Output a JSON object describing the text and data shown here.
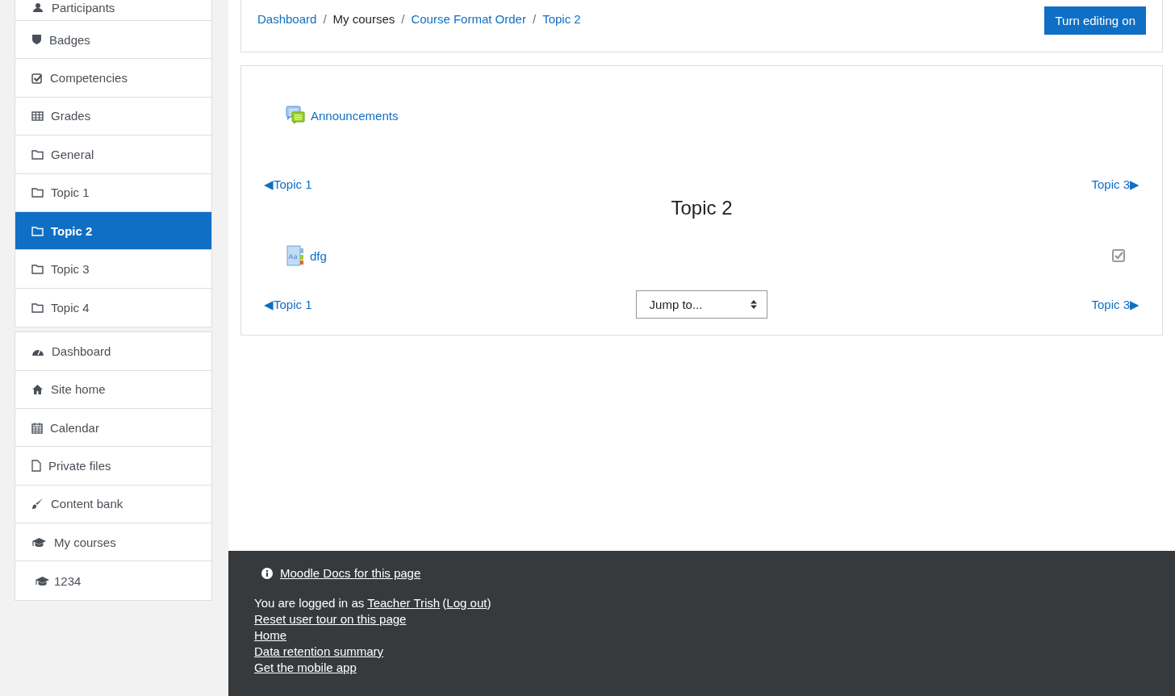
{
  "sidebar": {
    "blocks": [
      {
        "items": [
          {
            "label": "Participants",
            "selected": false
          },
          {
            "label": "Badges",
            "selected": false
          },
          {
            "label": "Competencies",
            "selected": false
          },
          {
            "label": "Grades",
            "selected": false
          },
          {
            "label": "General",
            "selected": false
          },
          {
            "label": "Topic 1",
            "selected": false
          },
          {
            "label": "Topic 2",
            "selected": true
          },
          {
            "label": "Topic 3",
            "selected": false
          },
          {
            "label": "Topic 4",
            "selected": false
          }
        ]
      },
      {
        "items": [
          {
            "label": "Dashboard",
            "selected": false
          },
          {
            "label": "Site home",
            "selected": false
          },
          {
            "label": "Calendar",
            "selected": false
          },
          {
            "label": "Private files",
            "selected": false
          },
          {
            "label": "Content bank",
            "selected": false
          },
          {
            "label": "My courses",
            "selected": false
          },
          {
            "label": "1234",
            "selected": false
          }
        ]
      }
    ]
  },
  "breadcrumb": [
    {
      "label": "Dashboard",
      "link": true
    },
    {
      "separator": "/",
      "label": "My courses",
      "link": false
    },
    {
      "separator": "/",
      "label": "Course Format Order",
      "link": true
    },
    {
      "separator": "/",
      "label": "Topic 2",
      "link": true
    }
  ],
  "edit_button": "Turn editing on",
  "general_activities": [
    {
      "kind": "forum",
      "name": "Announcements"
    }
  ],
  "section": {
    "top_nav": {
      "prev": "◀Topic 1",
      "next": "Topic 3▶"
    },
    "title": "Topic 2",
    "bottom_nav": {
      "prev": "◀Topic 1",
      "next": "Topic 3▶"
    },
    "activities": [
      {
        "kind": "page",
        "name": "dfg",
        "checked": true
      }
    ],
    "jump": "Jump to..."
  },
  "footer": {
    "docs": "Moodle Docs for this page",
    "logged_in": "You are logged in as",
    "user": "Teacher Trish",
    "open_paren": "(",
    "logout": "Log out",
    "close_paren": ")",
    "links": [
      "Reset user tour on this page",
      "Home",
      "Data retention summary",
      "Get the mobile app"
    ]
  }
}
